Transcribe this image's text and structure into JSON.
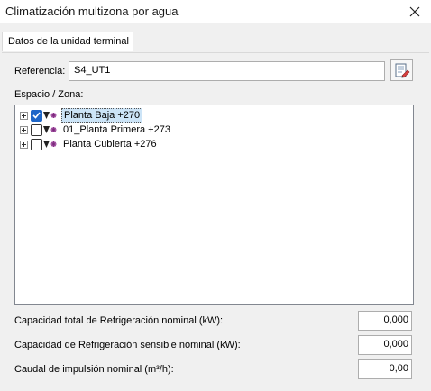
{
  "window": {
    "title": "Climatización multizona por agua"
  },
  "tabs": [
    {
      "label": "Datos de la unidad terminal"
    }
  ],
  "referencia": {
    "label": "Referencia:",
    "value": "S4_UT1"
  },
  "espacio": {
    "label": "Espacio / Zona:",
    "nodes": [
      {
        "label": "Planta Baja +270",
        "checked": true,
        "selected": true
      },
      {
        "label": "01_Planta Primera +273",
        "checked": false,
        "selected": false
      },
      {
        "label": "Planta Cubierta +276",
        "checked": false,
        "selected": false
      }
    ]
  },
  "fields": [
    {
      "label": "Capacidad total de Refrigeración nominal (kW):",
      "value": "0,000"
    },
    {
      "label": "Capacidad de Refrigeración sensible nominal (kW):",
      "value": "0,000"
    },
    {
      "label": "Caudal de impulsión nominal (m³/h):",
      "value": "0,00"
    }
  ],
  "colors": {
    "accent": "#1e66c8",
    "selection": "#cce4f7"
  },
  "icons": {
    "close": "close-icon",
    "edit": "edit-icon",
    "zone": "zone-icon"
  }
}
